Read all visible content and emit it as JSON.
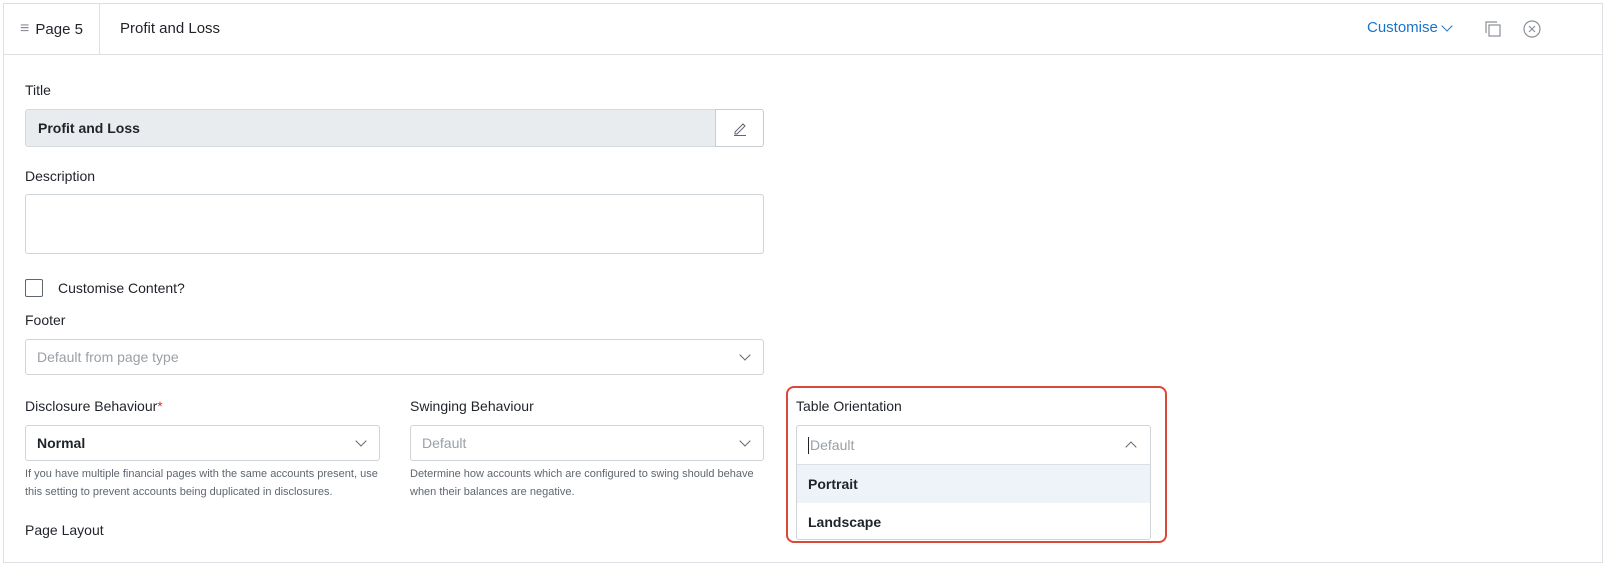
{
  "header": {
    "page_label": "Page 5",
    "title": "Profit and Loss",
    "customise_label": "Customise"
  },
  "form": {
    "title_label": "Title",
    "title_value": "Profit and Loss",
    "description_label": "Description",
    "description_value": "",
    "customise_content_label": "Customise Content?",
    "customise_content_checked": false,
    "footer_label": "Footer",
    "footer_placeholder": "Default from page type",
    "disclosure_label": "Disclosure Behaviour",
    "disclosure_required_mark": "*",
    "disclosure_value": "Normal",
    "disclosure_help": "If you have multiple financial pages with the same accounts present, use this setting to prevent accounts being duplicated in disclosures.",
    "swinging_label": "Swinging Behaviour",
    "swinging_placeholder": "Default",
    "swinging_help": "Determine how accounts which are configured to swing should behave when their balances are negative.",
    "table_orientation_label": "Table Orientation",
    "table_orientation_placeholder": "Default",
    "table_orientation_options": [
      "Portrait",
      "Landscape"
    ],
    "page_layout_label": "Page Layout"
  },
  "colors": {
    "accent": "#1a73c9",
    "highlight": "#d9493a",
    "required": "#d93636"
  },
  "icons": {
    "menu": "hamburger-icon",
    "copy": "copy-icon",
    "close": "close-icon",
    "edit": "pencil-icon"
  }
}
